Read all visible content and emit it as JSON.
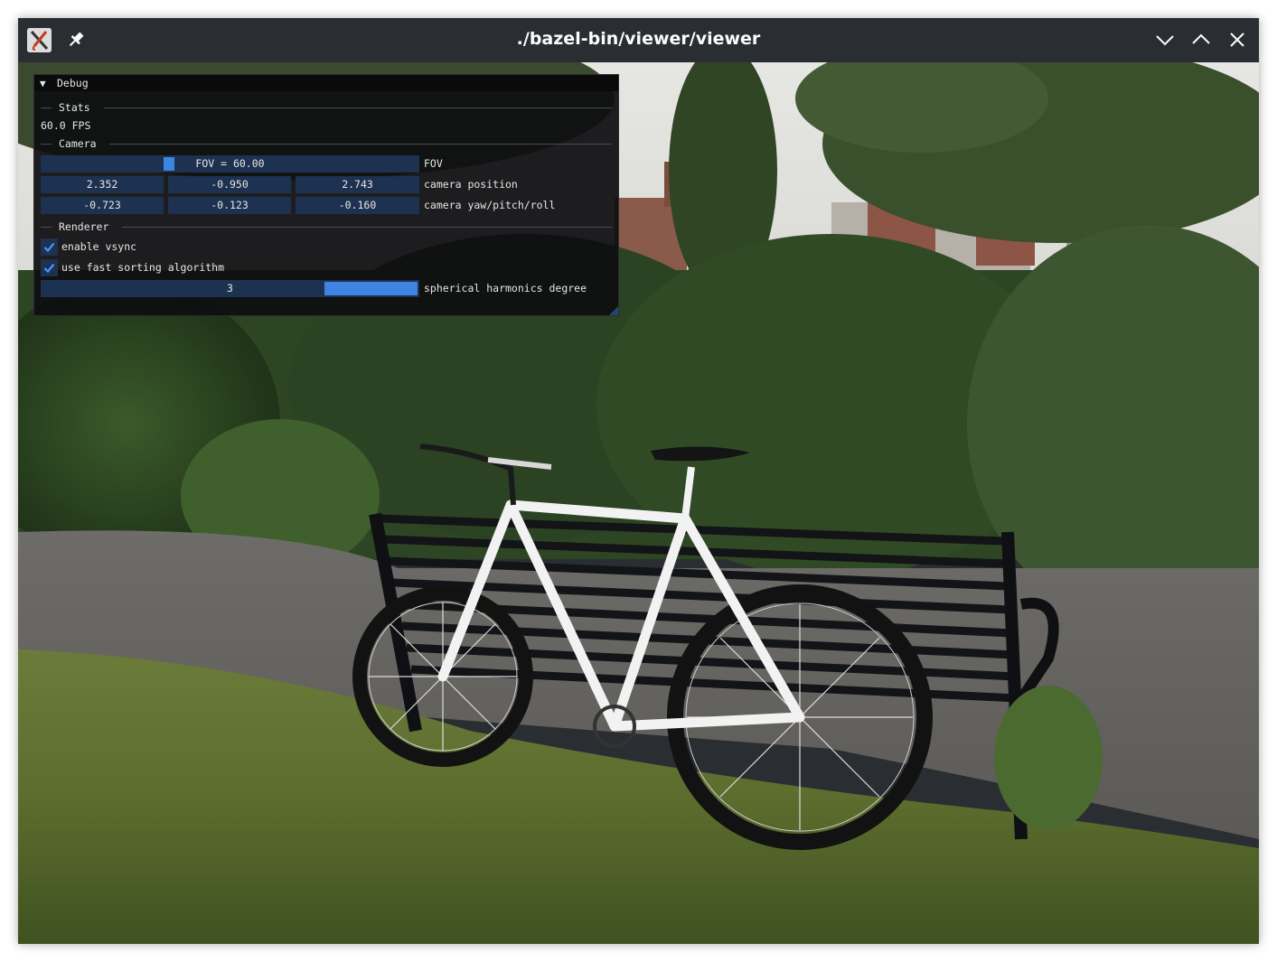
{
  "window": {
    "title": "./bazel-bin/viewer/viewer",
    "icons": {
      "app": "app-icon",
      "pin": "pin-icon",
      "minimize": "chevron-down-icon",
      "maximize": "chevron-up-icon",
      "close": "close-icon"
    }
  },
  "debug": {
    "title": "Debug",
    "stats": {
      "header": "Stats",
      "fps": "60.0 FPS"
    },
    "camera": {
      "header": "Camera",
      "fov_slider_text": "FOV = 60.00",
      "fov_value": 60,
      "fov_range": [
        0,
        180
      ],
      "fov_label": "FOV",
      "position": [
        "2.352",
        "-0.950",
        "2.743"
      ],
      "position_label": "camera position",
      "ypr": [
        "-0.723",
        "-0.123",
        "-0.160"
      ],
      "ypr_label": "camera yaw/pitch/roll"
    },
    "renderer": {
      "header": "Renderer",
      "vsync_label": "enable vsync",
      "vsync_checked": true,
      "fast_sort_label": "use fast sorting algorithm",
      "fast_sort_checked": true,
      "sh_degree_value": "3",
      "sh_degree_label": "spherical harmonics degree"
    }
  },
  "colors": {
    "titlebar": "#2a2e32",
    "frame_bg": "#1d3150",
    "accent": "#3d85e0"
  }
}
